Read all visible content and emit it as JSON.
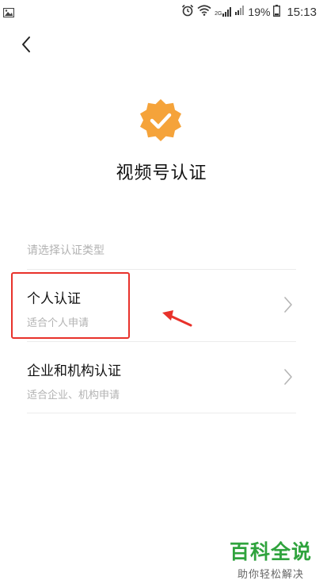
{
  "status_bar": {
    "network_label": "2G",
    "battery_percent": "19%",
    "time": "15:13"
  },
  "header": {
    "back_icon": "chevron-left-icon"
  },
  "badge": {
    "icon": "verified-badge-icon",
    "color": "#f5a33a"
  },
  "page": {
    "title": "视频号认证",
    "section_label": "请选择认证类型"
  },
  "options": [
    {
      "title": "个人认证",
      "subtitle": "适合个人申请"
    },
    {
      "title": "企业和机构认证",
      "subtitle": "适合企业、机构申请"
    }
  ],
  "annotation": {
    "color": "#e8322b"
  },
  "watermark": {
    "main": "百科全说",
    "sub": "助你轻松解决"
  }
}
